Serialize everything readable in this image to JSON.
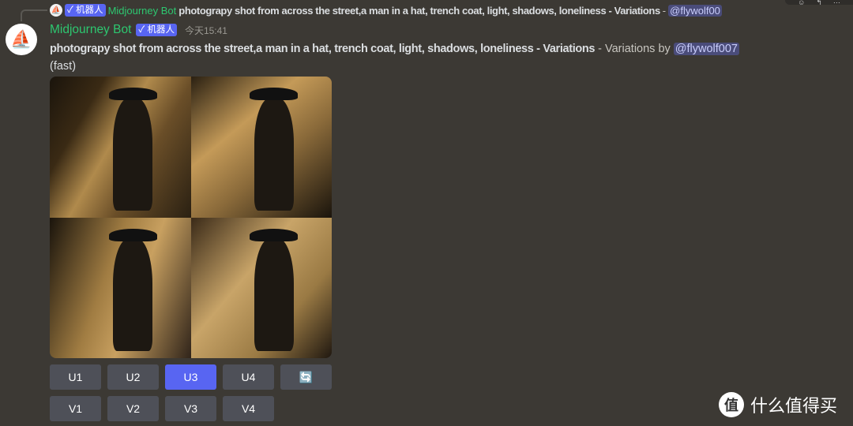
{
  "reply": {
    "bot_badge": "✓ 机器人",
    "author": "Midjourney Bot",
    "prompt": "photograpy shot from across the street,a man in a hat, trench coat, light, shadows, loneliness - Variations",
    "sep": " - ",
    "mention": "@flywolf00"
  },
  "message": {
    "author": "Midjourney Bot",
    "bot_badge": "✓ 机器人",
    "timestamp": "今天15:41",
    "prompt": "photograpy shot from across the street,a man in a hat, trench coat, light, shadows, loneliness - Variations",
    "suffix": " - Variations by ",
    "mention": "@flywolf007",
    "mode": "(fast)"
  },
  "buttons_upscale": [
    "U1",
    "U2",
    "U3",
    "U4"
  ],
  "active_button": "U3",
  "buttons_variation": [
    "V1",
    "V2",
    "V3",
    "V4"
  ],
  "refresh_icon": "🔄",
  "watermark": {
    "icon": "值",
    "text": "什么值得买"
  },
  "colors": {
    "accent": "#5865f2",
    "bot_name": "#2dc770",
    "background": "#3c3934"
  }
}
